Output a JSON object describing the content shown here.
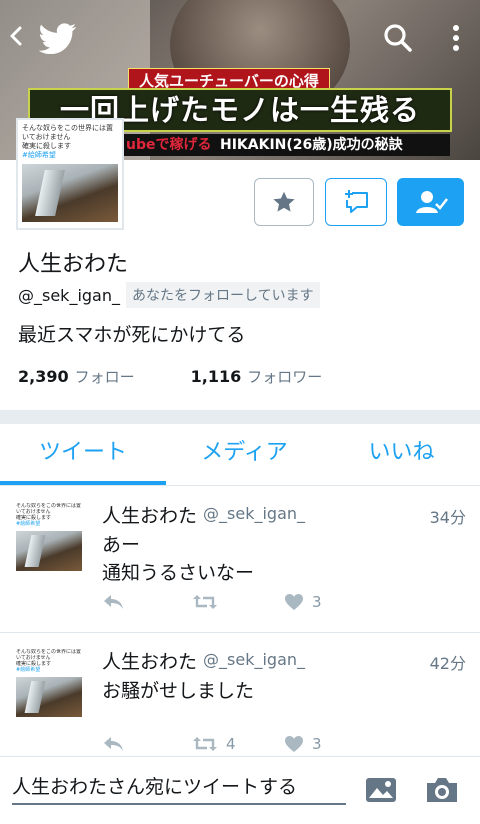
{
  "header": {
    "banner_tag": "人気ユーチューバーの心得",
    "banner_headline": "一回上げたモノは一生残る",
    "banner_sub_red": "ubeで稼げる",
    "banner_sub": "HIKAKIN(26歳)成功の秘訣"
  },
  "avatar": {
    "caption_line1": "そんな奴らをこの世界には置いておけません",
    "caption_line2": "確実に殺します",
    "caption_tag": "#絵師希望"
  },
  "profile": {
    "name": "人生おわた",
    "handle": "@_sek_igan_",
    "follows_you": "あなたをフォローしています",
    "bio": "最近スマホが死にかけてる",
    "following_count": "2,390",
    "following_label": "フォロー",
    "followers_count": "1,116",
    "followers_label": "フォロワー"
  },
  "tabs": [
    "ツイート",
    "メディア",
    "いいね"
  ],
  "tweets": [
    {
      "name": "人生おわた",
      "handle": "@_sek_igan_",
      "time": "34分",
      "line1": "あー",
      "line2": "通知うるさいなー",
      "retweets": "",
      "likes": "3"
    },
    {
      "name": "人生おわた",
      "handle": "@_sek_igan_",
      "time": "42分",
      "line1": "お騒がせしました",
      "line2": "",
      "retweets": "4",
      "likes": "3"
    }
  ],
  "composer": {
    "placeholder": "人生おわたさん宛にツイートする"
  },
  "colors": {
    "accent": "#1da1f2",
    "text": "#14171a",
    "secondary": "#657786"
  }
}
